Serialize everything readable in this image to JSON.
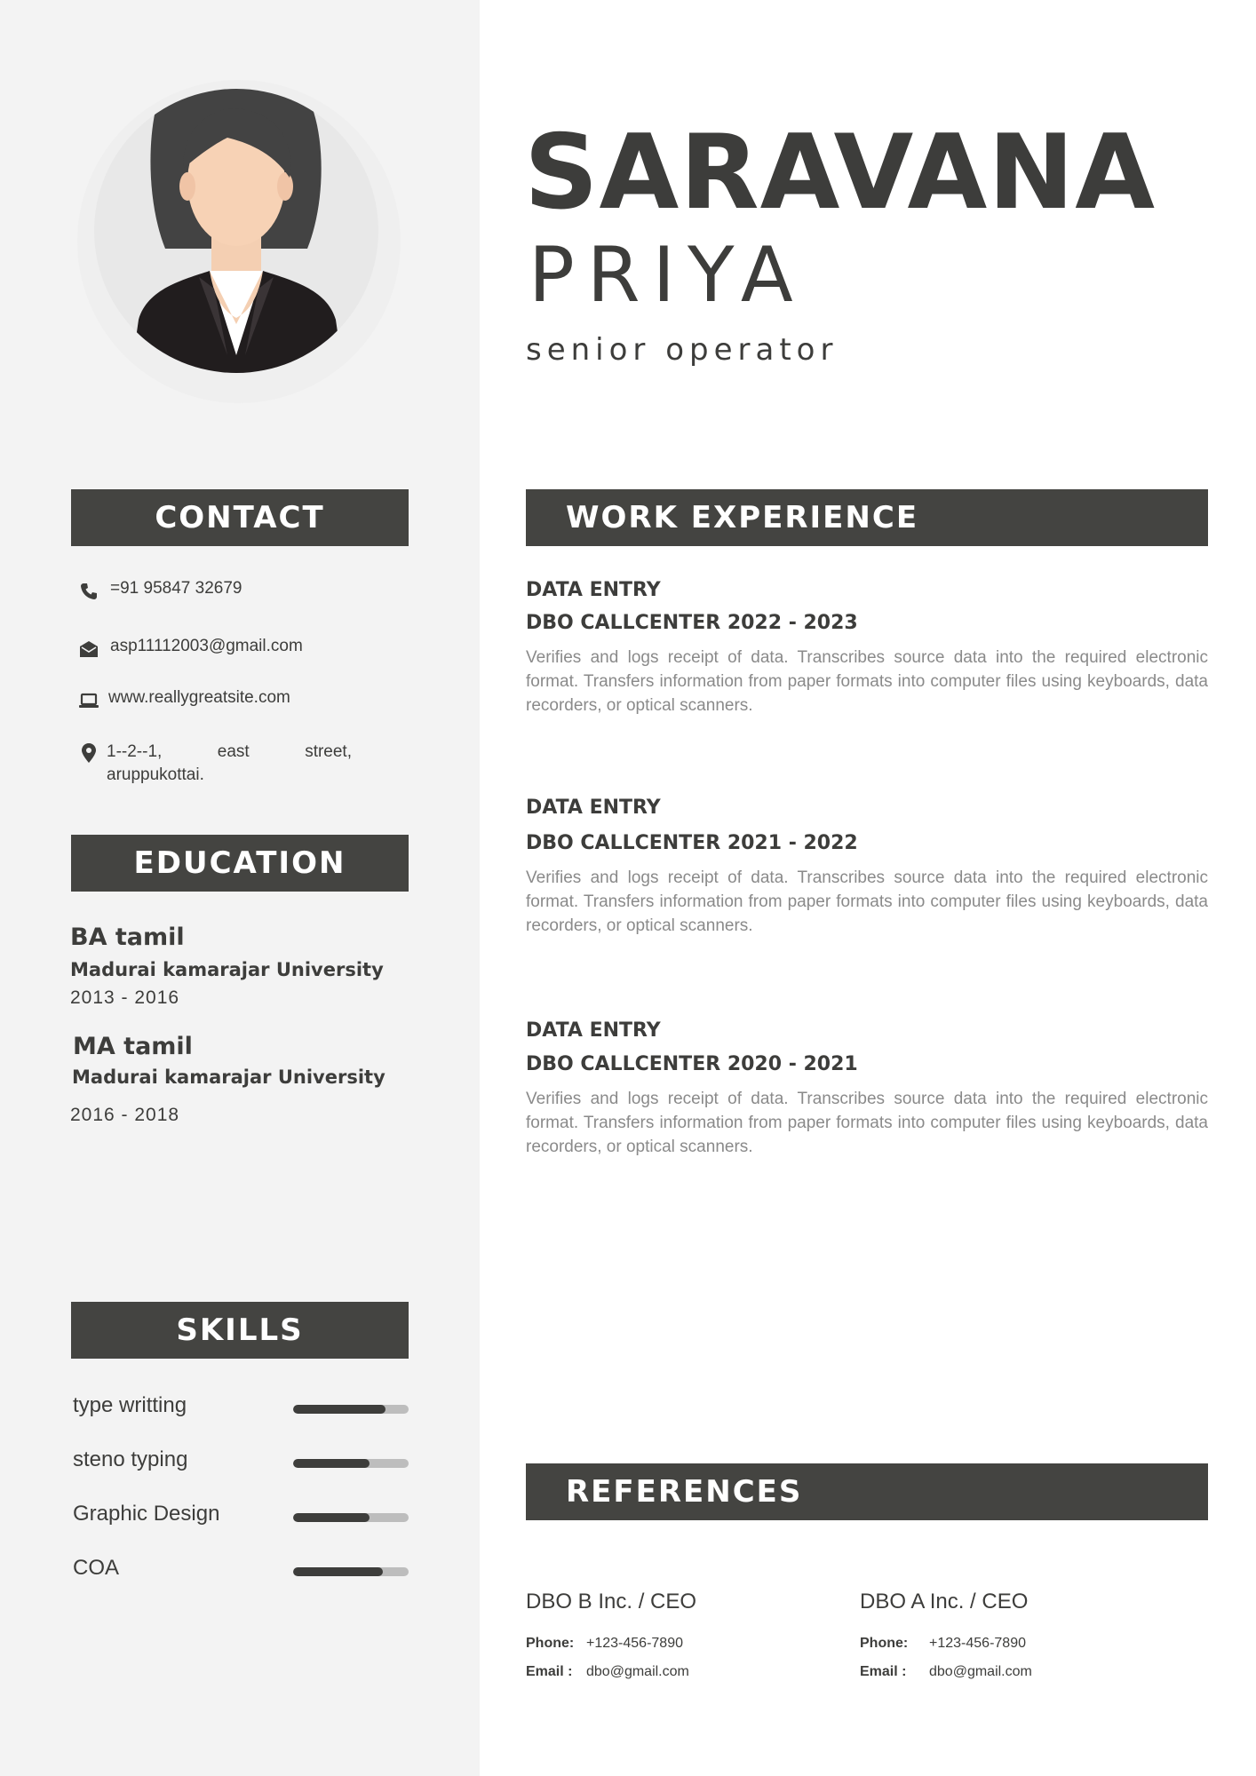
{
  "header": {
    "first_name": "SARAVANA",
    "last_name": "PRIYA",
    "title": "senior operator"
  },
  "contact": {
    "heading": "CONTACT",
    "phone": "=91  95847 32679",
    "email": "asp11112003@gmail.com",
    "website": "www.reallygreatsite.com",
    "address": "1--2--1, east street, aruppukottai.",
    "icons": [
      "phone-icon",
      "envelope-icon",
      "laptop-icon",
      "location-pin-icon"
    ]
  },
  "education": {
    "heading": "EDUCATION",
    "items": [
      {
        "degree": "BA tamil",
        "school": "Madurai kamarajar University",
        "years": "2013 - 2016"
      },
      {
        "degree": "MA tamil",
        "school": "Madurai kamarajar University",
        "years": "2016 - 2018"
      }
    ]
  },
  "skills": {
    "heading": "SKILLS",
    "items": [
      {
        "name": "type writting",
        "level": 0.8
      },
      {
        "name": "steno typing",
        "level": 0.66
      },
      {
        "name": "Graphic Design",
        "level": 0.66
      },
      {
        "name": "COA",
        "level": 0.78
      }
    ]
  },
  "work": {
    "heading": "WORK EXPERIENCE",
    "items": [
      {
        "role": "DATA  ENTRY",
        "company": "DBO  CALLCENTER 2022 - 2023",
        "description": "Verifies and logs receipt of data. Transcribes source data into the required electronic format. Transfers information from paper formats into computer files using keyboards, data recorders, or optical scanners."
      },
      {
        "role": "DATA  ENTRY",
        "company": "DBO CALLCENTER 2021 - 2022",
        "description": "Verifies and logs receipt of data. Transcribes source data into the required electronic format. Transfers information from paper formats into computer files using keyboards, data recorders, or optical scanners."
      },
      {
        "role": "DATA ENTRY",
        "company": "DBO CALLCENTER 2020 - 2021",
        "description": "Verifies and logs receipt of data. Transcribes source data into the required electronic format. Transfers information from paper formats into computer files using keyboards, data recorders, or optical scanners."
      }
    ]
  },
  "references": {
    "heading": "REFERENCES",
    "phone_label": "Phone:",
    "email_label": "Email :",
    "items": [
      {
        "name": "DBO B Inc. / CEO",
        "phone": "+123-456-7890",
        "email": "dbo@gmail.com"
      },
      {
        "name": "DBO A Inc. / CEO",
        "phone": "+123-456-7890",
        "email": "dbo@gmail.com"
      }
    ]
  },
  "colors": {
    "sidebar_bg": "#f3f3f3",
    "heading_bar": "#444441",
    "text": "#3d3d3b",
    "muted_text": "#8a8a8a",
    "skill_track": "#bdbdbd"
  }
}
